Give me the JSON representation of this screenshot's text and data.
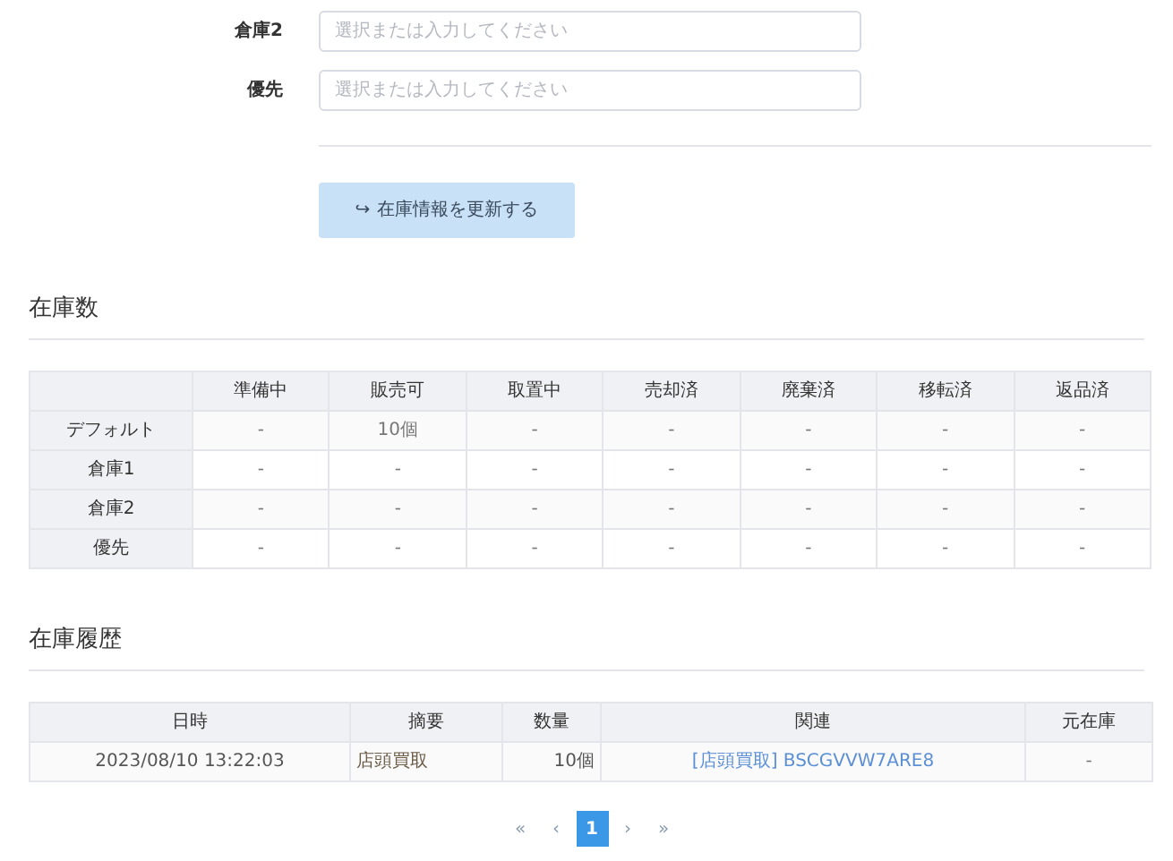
{
  "form_fields": [
    {
      "label": "倉庫2",
      "placeholder": "選択または入力してください"
    },
    {
      "label": "優先",
      "placeholder": "選択または入力してください"
    }
  ],
  "update_button": {
    "icon": "↪",
    "label": "在庫情報を更新する"
  },
  "stock_section": {
    "title": "在庫数",
    "columns": [
      "準備中",
      "販売可",
      "取置中",
      "売却済",
      "廃棄済",
      "移転済",
      "返品済"
    ],
    "rows": [
      {
        "name": "デフォルト",
        "cells": [
          "-",
          "10個",
          "-",
          "-",
          "-",
          "-",
          "-"
        ]
      },
      {
        "name": "倉庫1",
        "cells": [
          "-",
          "-",
          "-",
          "-",
          "-",
          "-",
          "-"
        ]
      },
      {
        "name": "倉庫2",
        "cells": [
          "-",
          "-",
          "-",
          "-",
          "-",
          "-",
          "-"
        ]
      },
      {
        "name": "優先",
        "cells": [
          "-",
          "-",
          "-",
          "-",
          "-",
          "-",
          "-"
        ]
      }
    ]
  },
  "history_section": {
    "title": "在庫履歴",
    "columns": [
      "日時",
      "摘要",
      "数量",
      "関連",
      "元在庫"
    ],
    "rows": [
      {
        "datetime": "2023/08/10 13:22:03",
        "summary": "店頭買取",
        "quantity": "10個",
        "related": "[店頭買取] BSCGVVW7ARE8",
        "source_stock": "-"
      }
    ]
  },
  "pagination": [
    {
      "label": "«",
      "selected": false
    },
    {
      "label": "‹",
      "selected": false
    },
    {
      "label": "1",
      "selected": true
    },
    {
      "label": "›",
      "selected": false
    },
    {
      "label": "»",
      "selected": false
    }
  ]
}
